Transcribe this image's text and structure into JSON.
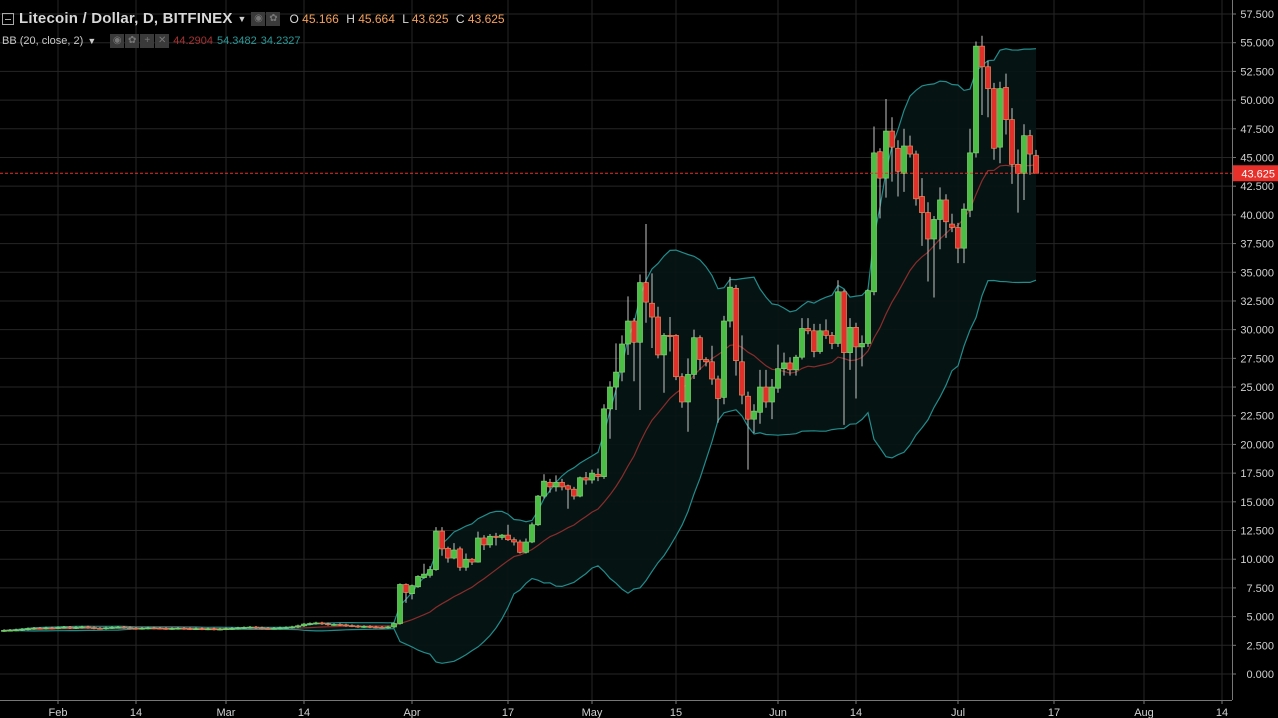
{
  "symbol": {
    "title": "Litecoin / Dollar, D, BITFINEX",
    "open_label": "O",
    "open": "45.166",
    "high_label": "H",
    "high": "45.664",
    "low_label": "L",
    "low": "43.625",
    "close_label": "C",
    "close": "43.625"
  },
  "indicator": {
    "title": "BB (20, close, 2)",
    "basis": "44.2904",
    "upper": "54.3482",
    "lower": "34.2327"
  },
  "icons": {
    "collapse": "minus-square-icon",
    "visibility": "eye-icon",
    "settings": "gear-icon",
    "add": "plus-icon",
    "remove": "close-icon",
    "menu": "caret-down-icon"
  },
  "colors": {
    "up": "#4cbd45",
    "down": "#e0302a",
    "wick": "#c4c4c4",
    "band": "#228c8c",
    "basis": "#8a2c2c",
    "fill": "#071515",
    "last_price": "#e8302a",
    "grid": "#262626",
    "axis_text": "#d0d0d0"
  },
  "last_price": {
    "value": 43.625,
    "label": "43.625"
  },
  "price_axis": {
    "ticks": [
      "57.500",
      "55.000",
      "52.500",
      "50.000",
      "47.500",
      "45.000",
      "42.500",
      "40.000",
      "37.500",
      "35.000",
      "32.500",
      "30.000",
      "27.500",
      "25.000",
      "22.500",
      "20.000",
      "17.500",
      "15.000",
      "12.500",
      "10.000",
      "7.500",
      "5.000",
      "2.500",
      "0.000"
    ]
  },
  "chart_data": {
    "type": "candlestick",
    "title": "Litecoin / Dollar, D, BITFINEX",
    "x_unit": "days since Feb 1",
    "first_candle_day": -9,
    "ylim": [
      0,
      57.5
    ],
    "grid": true,
    "date_ticks": [
      {
        "label": "Feb",
        "day": 0
      },
      {
        "label": "14",
        "day": 13
      },
      {
        "label": "Mar",
        "day": 28
      },
      {
        "label": "14",
        "day": 41
      },
      {
        "label": "Apr",
        "day": 59
      },
      {
        "label": "17",
        "day": 75
      },
      {
        "label": "May",
        "day": 89
      },
      {
        "label": "15",
        "day": 103
      },
      {
        "label": "Jun",
        "day": 120
      },
      {
        "label": "14",
        "day": 133
      },
      {
        "label": "Jul",
        "day": 150
      },
      {
        "label": "17",
        "day": 166
      },
      {
        "label": "Aug",
        "day": 181
      },
      {
        "label": "14",
        "day": 194
      }
    ],
    "flat_closes": [
      3.8,
      3.82,
      3.85,
      3.9,
      3.95,
      4.0,
      3.98,
      4.02,
      4.0,
      4.05,
      4.08,
      4.02,
      4.06,
      4.1,
      4.05,
      4.0,
      3.98,
      4.03,
      4.06,
      4.08,
      4.04,
      4.0,
      3.97,
      3.99,
      4.02,
      4.0,
      3.98,
      3.95,
      3.97,
      3.99,
      3.96,
      3.93,
      3.95,
      3.92,
      3.94,
      3.9,
      3.92,
      3.95,
      3.98,
      4.02,
      4.05,
      4.08,
      4.03,
      4.0,
      3.98,
      4.0,
      4.03,
      4.05,
      4.1,
      4.2,
      4.35,
      4.4,
      4.45,
      4.38,
      4.3,
      4.32,
      4.28,
      4.22,
      4.18,
      4.12,
      4.15,
      4.1,
      4.08,
      4.05,
      4.1,
      4.4
    ],
    "ohlc": [
      [
        4.4,
        7.9,
        4.3,
        7.8
      ],
      [
        7.8,
        7.9,
        6.2,
        7.1
      ],
      [
        7.0,
        7.8,
        6.5,
        7.7
      ],
      [
        7.6,
        8.6,
        7.5,
        8.5
      ],
      [
        8.4,
        9.6,
        8.3,
        8.7
      ],
      [
        8.6,
        9.4,
        8.4,
        9.1
      ],
      [
        9.1,
        12.8,
        9.0,
        12.45
      ],
      [
        12.45,
        12.8,
        10.3,
        10.9
      ],
      [
        10.95,
        11.1,
        9.7,
        10.1
      ],
      [
        10.1,
        11.4,
        10.0,
        10.8
      ],
      [
        10.9,
        11.1,
        9.0,
        9.3
      ],
      [
        9.3,
        10.5,
        9.0,
        10.0
      ],
      [
        10.0,
        10.1,
        9.5,
        9.75
      ],
      [
        9.75,
        12.4,
        9.7,
        11.85
      ],
      [
        11.85,
        12.1,
        10.8,
        11.25
      ],
      [
        11.25,
        12.2,
        11.0,
        12.0
      ],
      [
        12.0,
        12.3,
        11.2,
        11.9
      ],
      [
        11.9,
        12.2,
        11.7,
        12.1
      ],
      [
        12.1,
        13.0,
        11.6,
        11.7
      ],
      [
        11.7,
        11.9,
        11.2,
        11.5
      ],
      [
        11.5,
        11.7,
        10.5,
        10.6
      ],
      [
        10.6,
        11.8,
        10.5,
        11.5
      ],
      [
        11.5,
        13.2,
        11.4,
        13.0
      ],
      [
        13.0,
        15.6,
        12.9,
        15.5
      ],
      [
        15.5,
        17.4,
        15.3,
        16.8
      ],
      [
        16.7,
        17.0,
        15.8,
        16.3
      ],
      [
        16.3,
        17.3,
        15.9,
        16.7
      ],
      [
        16.7,
        17.0,
        16.0,
        16.3
      ],
      [
        16.4,
        16.5,
        14.4,
        16.1
      ],
      [
        16.1,
        16.3,
        15.2,
        15.5
      ],
      [
        15.5,
        17.2,
        15.4,
        17.1
      ],
      [
        17.1,
        17.6,
        16.5,
        16.9
      ],
      [
        16.9,
        17.8,
        16.6,
        17.5
      ],
      [
        17.4,
        17.9,
        16.8,
        17.2
      ],
      [
        17.2,
        23.5,
        17.0,
        23.1
      ],
      [
        23.1,
        25.5,
        20.5,
        25.0
      ],
      [
        25.0,
        28.8,
        23.0,
        26.3
      ],
      [
        26.3,
        29.5,
        25.5,
        28.75
      ],
      [
        28.75,
        32.9,
        27.8,
        30.75
      ],
      [
        30.75,
        31.0,
        25.5,
        28.9
      ],
      [
        28.9,
        34.8,
        23.0,
        34.1
      ],
      [
        34.1,
        39.2,
        30.6,
        32.4
      ],
      [
        32.3,
        34.9,
        28.4,
        31.1
      ],
      [
        31.1,
        32.0,
        27.5,
        27.8
      ],
      [
        27.8,
        29.7,
        24.5,
        29.5
      ],
      [
        29.5,
        31.1,
        28.1,
        29.4
      ],
      [
        29.5,
        29.6,
        25.6,
        25.9
      ],
      [
        25.9,
        26.2,
        23.2,
        23.7
      ],
      [
        23.7,
        27.5,
        21.1,
        26.1
      ],
      [
        26.1,
        30.0,
        25.7,
        29.3
      ],
      [
        29.3,
        29.5,
        26.5,
        27.4
      ],
      [
        27.4,
        27.6,
        26.8,
        27.2
      ],
      [
        27.2,
        28.6,
        25.2,
        25.7
      ],
      [
        25.7,
        26.0,
        21.9,
        24.0
      ],
      [
        24.1,
        31.2,
        23.5,
        30.75
      ],
      [
        30.75,
        34.6,
        30.2,
        33.7
      ],
      [
        33.6,
        33.9,
        26.0,
        27.3
      ],
      [
        27.2,
        29.5,
        23.5,
        24.3
      ],
      [
        24.2,
        24.6,
        17.8,
        22.2
      ],
      [
        22.2,
        23.5,
        21.0,
        22.9
      ],
      [
        22.8,
        26.5,
        21.8,
        25.0
      ],
      [
        25.0,
        26.5,
        23.2,
        23.7
      ],
      [
        23.7,
        25.7,
        22.2,
        25.0
      ],
      [
        24.9,
        28.7,
        24.5,
        26.6
      ],
      [
        26.6,
        28.0,
        26.0,
        27.1
      ],
      [
        27.1,
        27.6,
        26.0,
        26.5
      ],
      [
        26.5,
        27.8,
        26.0,
        27.6
      ],
      [
        27.6,
        31.0,
        27.4,
        30.1
      ],
      [
        30.1,
        31.0,
        29.6,
        29.9
      ],
      [
        29.9,
        30.5,
        27.6,
        28.1
      ],
      [
        28.1,
        30.5,
        27.9,
        29.9
      ],
      [
        29.9,
        30.9,
        29.2,
        29.5
      ],
      [
        29.5,
        29.8,
        28.3,
        28.8
      ],
      [
        28.8,
        34.3,
        28.5,
        33.3
      ],
      [
        33.3,
        33.5,
        21.7,
        28.0
      ],
      [
        28.0,
        31.0,
        26.5,
        30.2
      ],
      [
        30.2,
        30.6,
        24.0,
        28.5
      ],
      [
        28.5,
        29.5,
        26.8,
        28.8
      ],
      [
        28.8,
        33.5,
        28.5,
        33.4
      ],
      [
        33.3,
        47.7,
        33.0,
        45.4
      ],
      [
        45.5,
        45.8,
        39.7,
        43.2
      ],
      [
        43.2,
        50.1,
        41.5,
        47.3
      ],
      [
        47.3,
        48.5,
        42.9,
        45.9
      ],
      [
        45.8,
        46.5,
        41.6,
        43.8
      ],
      [
        43.6,
        47.5,
        42.0,
        46.0
      ],
      [
        46.0,
        46.9,
        45.0,
        45.3
      ],
      [
        45.3,
        45.6,
        40.8,
        41.4
      ],
      [
        41.6,
        43.2,
        37.3,
        40.2
      ],
      [
        40.2,
        41.1,
        34.2,
        37.9
      ],
      [
        37.9,
        39.9,
        32.8,
        39.6
      ],
      [
        39.6,
        42.4,
        37.0,
        41.3
      ],
      [
        41.3,
        41.8,
        38.0,
        39.4
      ],
      [
        39.2,
        40.1,
        38.5,
        38.9
      ],
      [
        38.9,
        39.3,
        35.8,
        37.1
      ],
      [
        37.1,
        41.0,
        35.8,
        40.5
      ],
      [
        40.4,
        47.5,
        39.8,
        45.4
      ],
      [
        45.4,
        55.1,
        45.0,
        54.7
      ],
      [
        54.7,
        55.6,
        48.7,
        52.9
      ],
      [
        52.9,
        53.4,
        48.5,
        51.0
      ],
      [
        51.0,
        51.5,
        44.8,
        45.8
      ],
      [
        45.9,
        51.6,
        44.5,
        51.0
      ],
      [
        51.1,
        52.3,
        47.0,
        48.3
      ],
      [
        48.3,
        49.3,
        42.7,
        44.4
      ],
      [
        44.4,
        45.7,
        40.2,
        43.6
      ],
      [
        43.6,
        47.9,
        41.3,
        46.9
      ],
      [
        46.9,
        47.4,
        43.5,
        45.3
      ],
      [
        45.166,
        45.664,
        43.625,
        43.625
      ]
    ],
    "indicator": {
      "name": "BB",
      "period": 20,
      "source": "close",
      "stddev": 2
    }
  }
}
